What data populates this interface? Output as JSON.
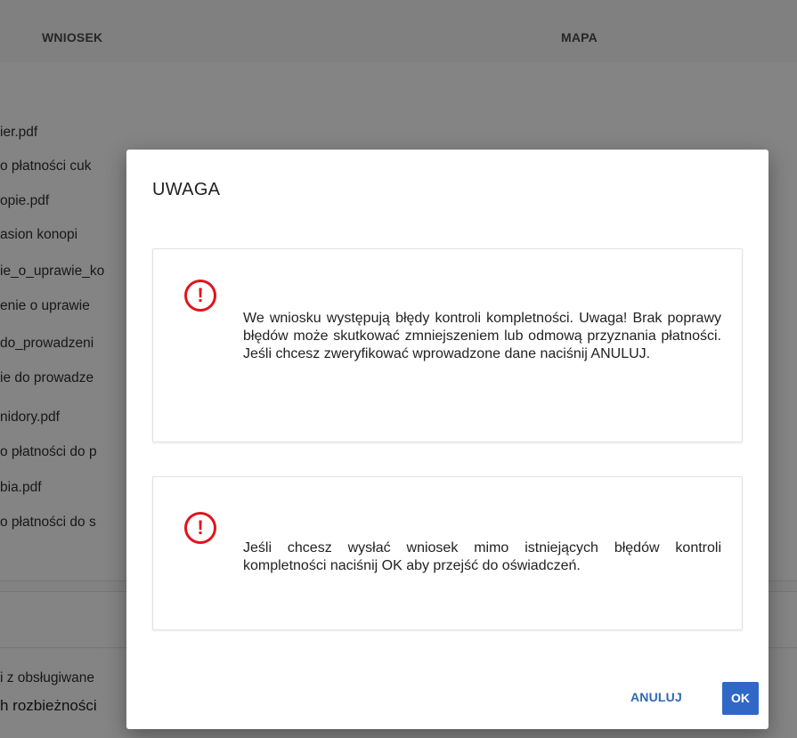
{
  "background": {
    "tabs": [
      "WNIOSEK",
      "MAPA"
    ],
    "files": [
      "ier.pdf",
      "o płatności cuk",
      "opie.pdf",
      "asion konopi",
      "ie_o_uprawie_ko",
      "enie o uprawie",
      "do_prowadzeni",
      "ie do prowadze",
      "nidory.pdf",
      "o płatności do p",
      "bia.pdf",
      "o płatności do s"
    ],
    "bottom_line_1": "i z obsługiwane",
    "bottom_line_2": "h rozbieżności"
  },
  "dialog": {
    "title": "UWAGA",
    "icon": "exclamation-circle-icon",
    "icon_glyph": "!",
    "icon_color": "#e0141e",
    "message_1": "We wniosku występują błędy kontroli kompletności. Uwaga! Brak poprawy błędów może skutkować zmniejszeniem lub odmową przyznania płatności. Jeśli chcesz zweryfikować wprowadzone dane naciśnij ANULUJ.",
    "message_2": "Jeśli chcesz wysłać wniosek mimo istniejących błędów kontroli kompletności naciśnij OK aby przejść do oświadczeń.",
    "cancel_label": "ANULUJ",
    "ok_label": "OK",
    "accent_color": "#2f68c7"
  }
}
